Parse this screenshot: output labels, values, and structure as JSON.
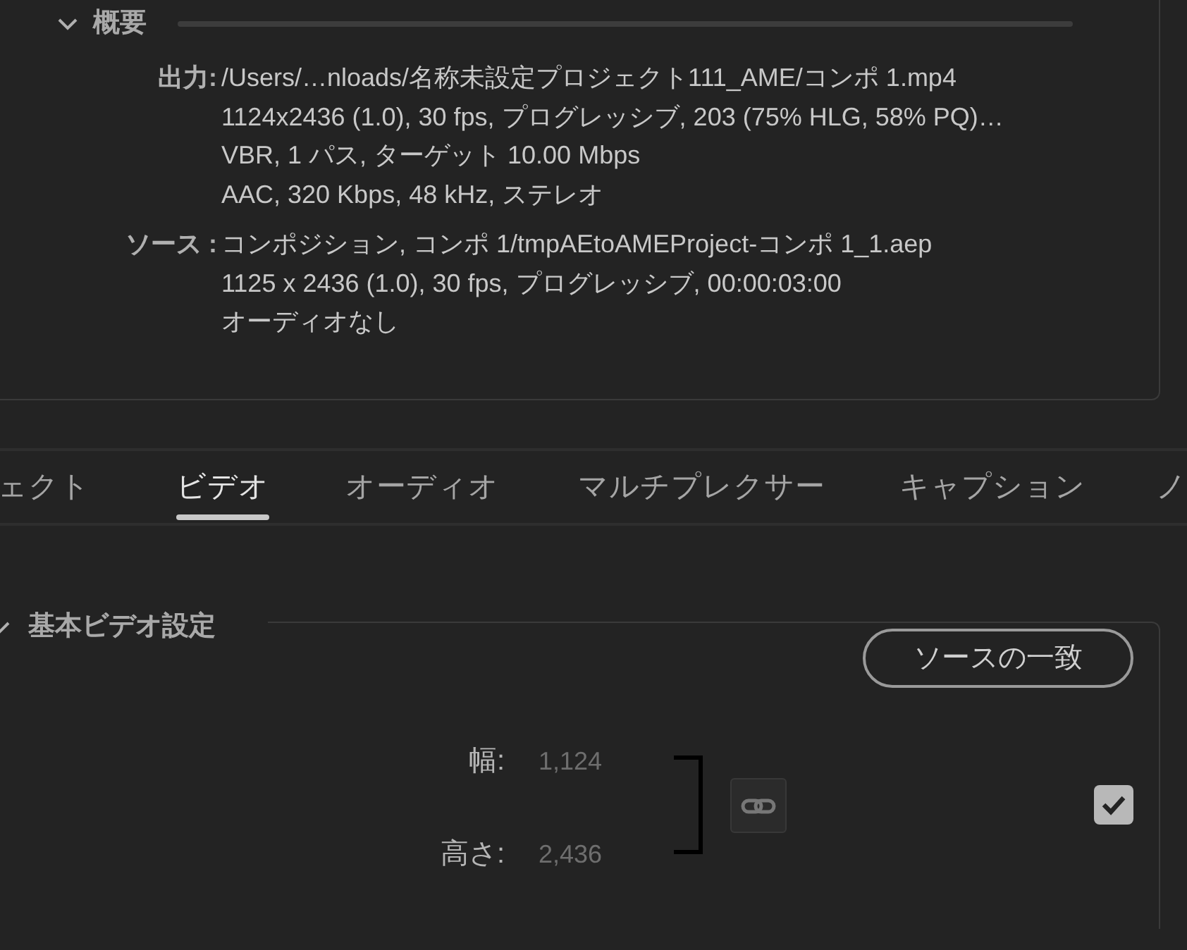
{
  "summary": {
    "title": "概要",
    "expanded": true,
    "rows": [
      {
        "label": "出力:",
        "lines": [
          "/Users/…nloads/名称未設定プロジェクト111_AME/コンポ 1.mp4",
          "1124x2436 (1.0), 30 fps, プログレッシブ, 203 (75% HLG, 58% PQ)…",
          "VBR, 1 パス, ターゲット 10.00 Mbps",
          "AAC, 320 Kbps, 48 kHz, ステレオ"
        ]
      },
      {
        "label": "ソース :",
        "lines": [
          "コンポジション, コンポ 1/tmpAEtoAMEProject-コンポ 1_1.aep",
          "1125 x 2436 (1.0), 30 fps, プログレッシブ, 00:00:03:00",
          "オーディオなし"
        ]
      }
    ]
  },
  "tabs": [
    {
      "label": "ェクト",
      "selected": false
    },
    {
      "label": "ビデオ",
      "selected": true
    },
    {
      "label": "オーディオ",
      "selected": false
    },
    {
      "label": "マルチプレクサー",
      "selected": false
    },
    {
      "label": "キャプション",
      "selected": false
    },
    {
      "label": "ノ",
      "selected": false
    }
  ],
  "video_section": {
    "title": "基本ビデオ設定",
    "expanded": true,
    "match_button": "ソースの一致",
    "width": {
      "label": "幅:",
      "value": "1,124"
    },
    "height": {
      "label": "高さ:",
      "value": "2,436"
    },
    "linked": true,
    "checked": true
  }
}
